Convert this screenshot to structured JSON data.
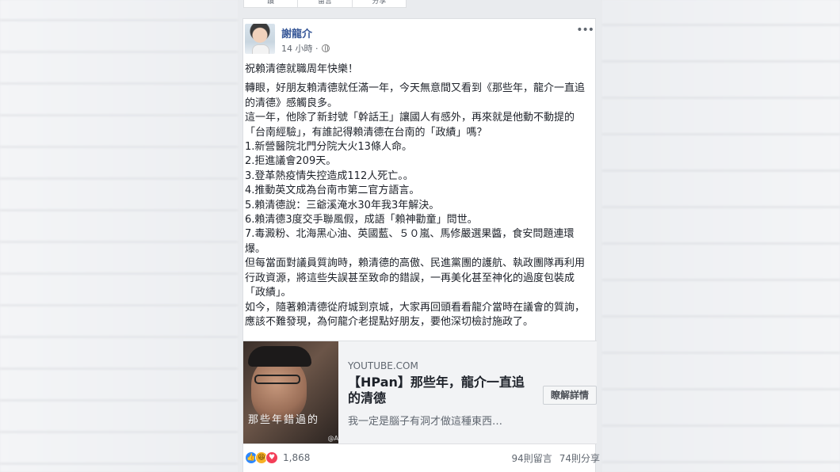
{
  "top_bar": {
    "items": [
      "讚",
      "留言",
      "分享"
    ]
  },
  "post": {
    "author": "謝龍介",
    "time": "14 小時 ·",
    "more": "•••",
    "paragraphs": [
      "祝賴清德就職周年快樂！",
      "轉眼，好朋友賴清德就任滿一年，今天無意間又看到《那些年，龍介一直追的清德》感觸良多。",
      "這一年，他除了新封號「幹話王」讓國人有感外，再來就是他動不動提的「台南經驗」，有誰記得賴清德在台南的「政績」嗎？",
      "1.新營醫院北門分院大火13條人命。",
      "2.拒進議會209天。",
      "3.登革熱疫情失控造成112人死亡。。",
      "4.推動英文成為台南市第二官方語言。",
      "5.賴清德說：三爺溪淹水30年我3年解決。",
      "6.賴清德3度交手聯風假，成語「賴神勸童」問世。",
      "7.毒澱粉、北海黑心油、英國藍、５０嵐、馬修嚴選果醬，食安問題連環爆。",
      "但每當面對議員質詢時，賴清德的高傲、民進黨團的護航、執政團隊再利用行政資源，將這些失誤甚至致命的錯誤，一再美化甚至神化的過度包裝成「政績」。",
      "如今，隨著賴清德從府城到京城，大家再回頭看看龍介當時在議會的質詢，應該不難發現，為何龍介老提點好朋友，要他深切檢討施政了。"
    ],
    "link": {
      "domain": "YOUTUBE.COM",
      "title": "【HPan】那些年，龍介一直追的清德",
      "description": "我一定是腦子有洞才做這種東西…",
      "button": "瞭解詳情",
      "thumb_caption": "那些年錯過的",
      "thumb_credit": "@A"
    },
    "reactions": {
      "count": "1,868",
      "comments": "94則留言",
      "shares": "74則分享"
    }
  },
  "colors": {
    "link_blue": "#385898",
    "like": "#2d88ff",
    "haha": "#f7b125",
    "love": "#f33e58"
  }
}
